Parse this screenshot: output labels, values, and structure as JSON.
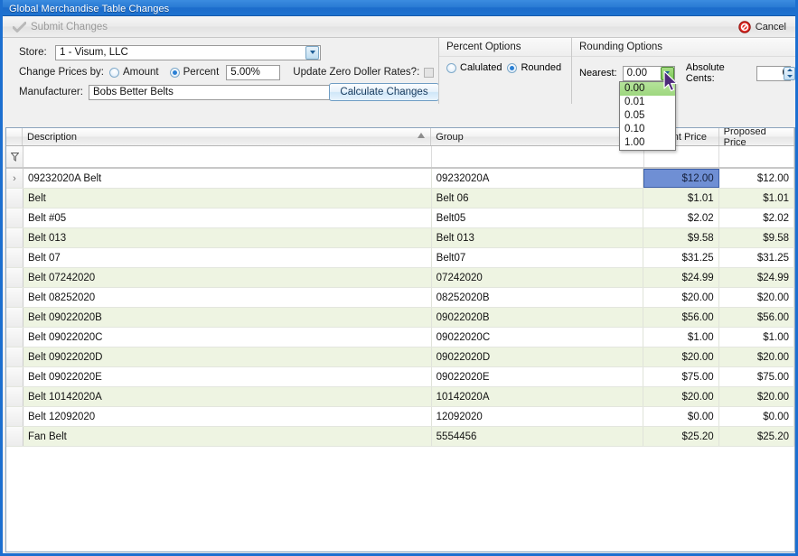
{
  "window": {
    "title": "Global Merchandise Table Changes"
  },
  "toolbar": {
    "submit_label": "Submit Changes",
    "submit_icon": "checkmark-icon",
    "cancel_label": "Cancel",
    "cancel_icon": "no-entry-icon"
  },
  "form": {
    "store_label": "Store:",
    "store_value": "1 - Visum, LLC",
    "calculate_label": "Calculate Changes",
    "change_prices_label": "Change Prices by:",
    "amount_label": "Amount",
    "amount_selected": false,
    "percent_label": "Percent",
    "percent_selected": true,
    "percent_value": "5.00%",
    "update_zero_label": "Update Zero Doller Rates?:",
    "update_zero_checked": false,
    "manufacturer_label": "Manufacturer:",
    "manufacturer_value": "Bobs Better Belts"
  },
  "percent_options": {
    "title": "Percent Options",
    "calculated_label": "Calulated",
    "calculated_selected": false,
    "rounded_label": "Rounded",
    "rounded_selected": true
  },
  "rounding_options": {
    "title": "Rounding Options",
    "nearest_label": "Nearest:",
    "nearest_value": "0.00",
    "nearest_options": [
      "0.00",
      "0.01",
      "0.05",
      "0.10",
      "1.00"
    ],
    "nearest_selected_index": 0,
    "absolute_cents_label": "Absolute Cents:",
    "absolute_cents_value": "0"
  },
  "grid": {
    "columns": [
      {
        "label": "Description",
        "sorted": "asc"
      },
      {
        "label": "Group",
        "sorted": ""
      },
      {
        "label": "Current Price",
        "sorted": ""
      },
      {
        "label": "Proposed Price",
        "sorted": ""
      }
    ],
    "filter_icon": "filter-funnel-icon",
    "selected_row_index": 0,
    "selected_column": "Current Price",
    "rows": [
      {
        "description": "09232020A Belt",
        "group": "09232020A",
        "current": "$12.00",
        "proposed": "$12.00"
      },
      {
        "description": "Belt",
        "group": "Belt 06",
        "current": "$1.01",
        "proposed": "$1.01"
      },
      {
        "description": "Belt #05",
        "group": "Belt05",
        "current": "$2.02",
        "proposed": "$2.02"
      },
      {
        "description": "Belt 013",
        "group": "Belt 013",
        "current": "$9.58",
        "proposed": "$9.58"
      },
      {
        "description": "Belt 07",
        "group": "Belt07",
        "current": "$31.25",
        "proposed": "$31.25"
      },
      {
        "description": "Belt 07242020",
        "group": "07242020",
        "current": "$24.99",
        "proposed": "$24.99"
      },
      {
        "description": "Belt 08252020",
        "group": "08252020B",
        "current": "$20.00",
        "proposed": "$20.00"
      },
      {
        "description": "Belt 09022020B",
        "group": "09022020B",
        "current": "$56.00",
        "proposed": "$56.00"
      },
      {
        "description": "Belt 09022020C",
        "group": "09022020C",
        "current": "$1.00",
        "proposed": "$1.00"
      },
      {
        "description": "Belt 09022020D",
        "group": "09022020D",
        "current": "$20.00",
        "proposed": "$20.00"
      },
      {
        "description": "Belt 09022020E",
        "group": "09022020E",
        "current": "$75.00",
        "proposed": "$75.00"
      },
      {
        "description": "Belt 10142020A",
        "group": "10142020A",
        "current": "$20.00",
        "proposed": "$20.00"
      },
      {
        "description": "Belt 12092020",
        "group": "12092020",
        "current": "$0.00",
        "proposed": "$0.00"
      },
      {
        "description": "Fan Belt",
        "group": "5554456",
        "current": "$25.20",
        "proposed": "$25.20"
      }
    ]
  },
  "colors": {
    "title_bar": "#2a7bd4",
    "window_border": "#1c6fd0",
    "row_alt": "#eef4e2",
    "selection": "#6f8fd4",
    "dropdown_highlight": "#9ed77f"
  }
}
